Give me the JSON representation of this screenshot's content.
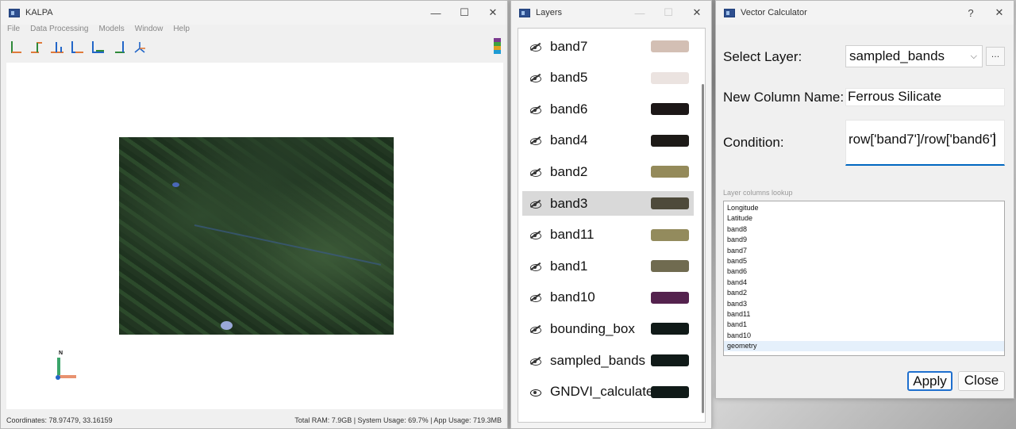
{
  "kalpa": {
    "title": "KALPA",
    "menu": [
      "File",
      "Data Processing",
      "Models",
      "Window",
      "Help"
    ],
    "tools": [
      "tool-1",
      "tool-2",
      "tool-3",
      "tool-4",
      "tool-5",
      "tool-6",
      "tool-7"
    ],
    "compass_label": "N",
    "status": {
      "coordinates": "Coordinates: 78.97479, 33.16159",
      "usage": "Total RAM: 7.9GB | System Usage: 69.7% | App Usage: 719.3MB"
    }
  },
  "layers": {
    "title": "Layers",
    "items": [
      {
        "label": "band7",
        "color": "#d3bfb4",
        "visible": false
      },
      {
        "label": "band5",
        "color": "#ebe3e0",
        "visible": false
      },
      {
        "label": "band6",
        "color": "#1c1717",
        "visible": false
      },
      {
        "label": "band4",
        "color": "#1d1a17",
        "visible": false
      },
      {
        "label": "band2",
        "color": "#948a5a",
        "visible": false
      },
      {
        "label": "band3",
        "color": "#4e4a3a",
        "visible": false,
        "selected": true
      },
      {
        "label": "band11",
        "color": "#938b5d",
        "visible": false
      },
      {
        "label": "band1",
        "color": "#706b50",
        "visible": false
      },
      {
        "label": "band10",
        "color": "#54224e",
        "visible": false
      },
      {
        "label": "bounding_box",
        "color": "#101a18",
        "visible": false
      },
      {
        "label": "sampled_bands",
        "color": "#101a18",
        "visible": false
      },
      {
        "label": "GNDVI_calculate",
        "color": "#101a18",
        "visible": true
      }
    ]
  },
  "vcalc": {
    "title": "Vector Calculator",
    "help": "?",
    "close": "✕",
    "select_layer_label": "Select Layer:",
    "select_layer_value": "sampled_bands",
    "new_column_label": "New Column Name:",
    "new_column_value": "Ferrous Silicate",
    "condition_label": "Condition:",
    "condition_value": "row['band7']/row['band6']",
    "lookup_label": "Layer columns lookup",
    "columns": [
      "Longitude",
      "Latitude",
      "band8",
      "band9",
      "band7",
      "band5",
      "band6",
      "band4",
      "band2",
      "band3",
      "band11",
      "band1",
      "band10",
      "geometry"
    ],
    "apply": "Apply",
    "close_btn": "Close"
  },
  "colors": {
    "accent": "#0067c0",
    "selection": "#d9d9d9"
  }
}
